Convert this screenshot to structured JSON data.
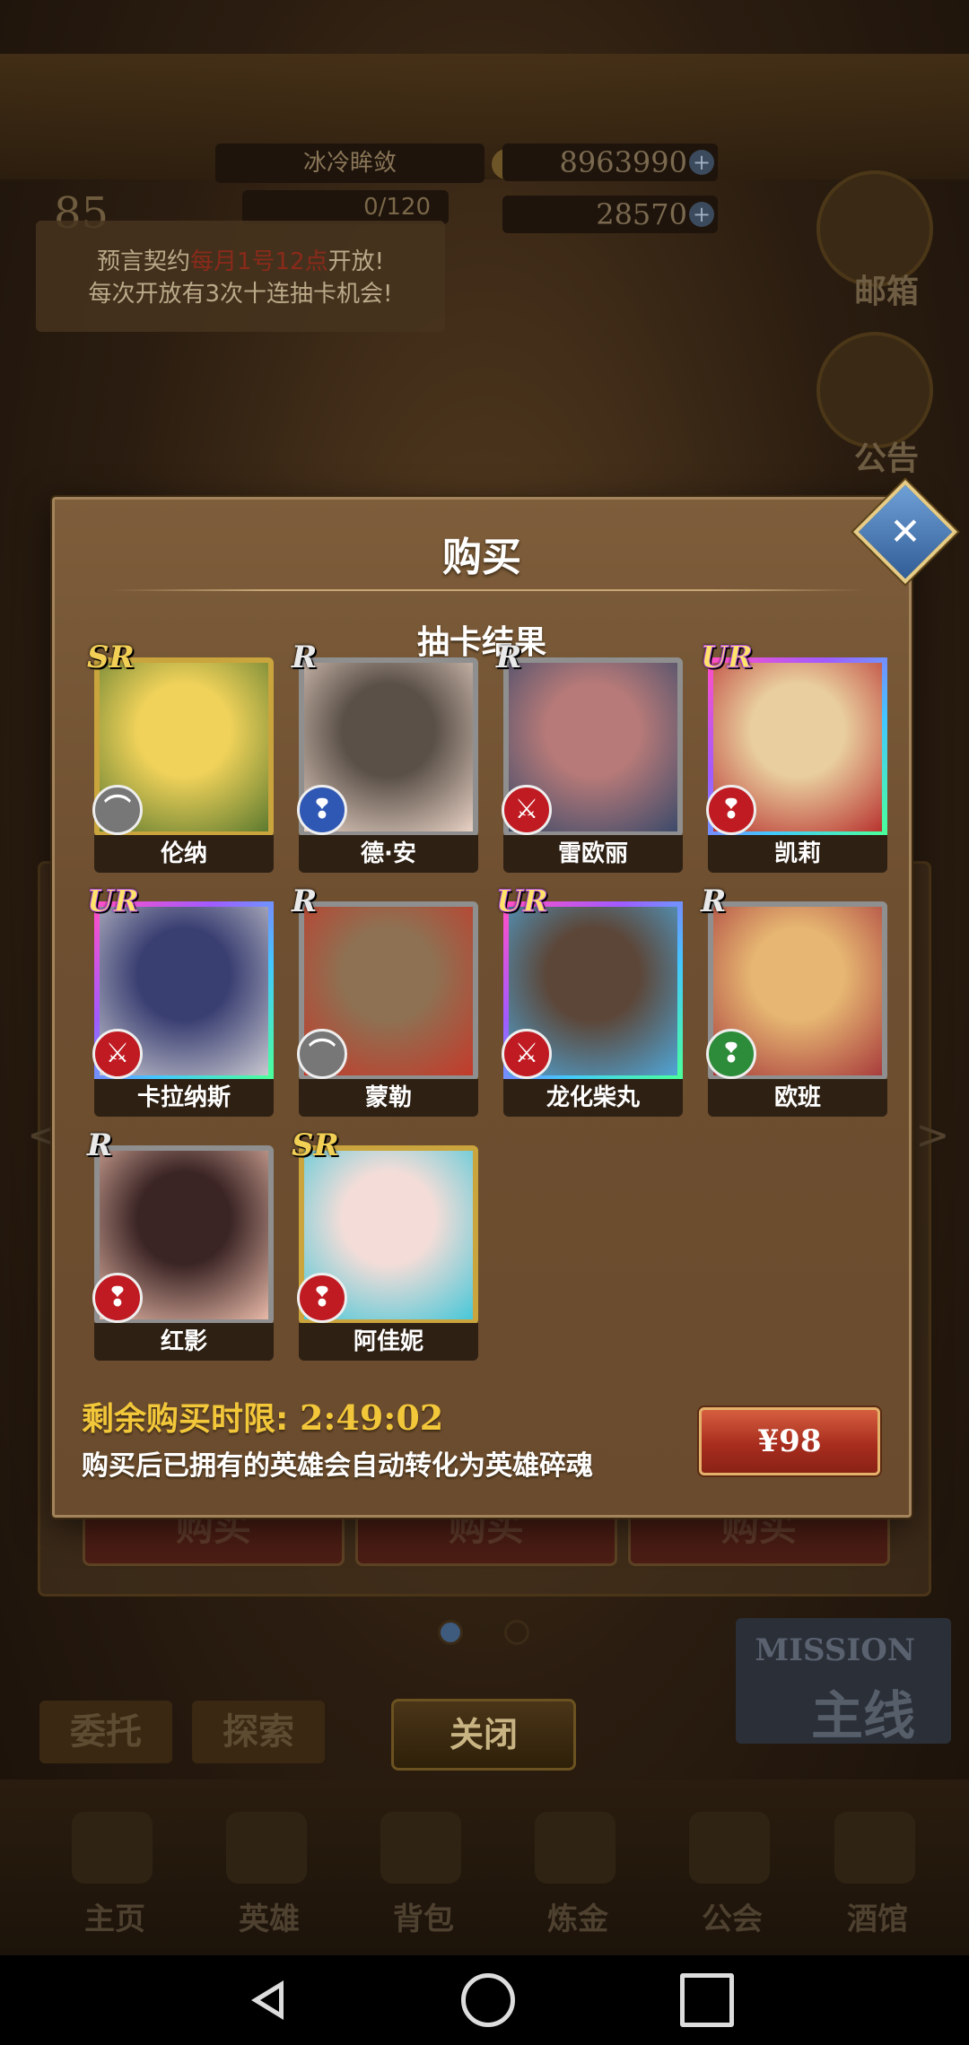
{
  "background": {
    "player_name": "冰冷眸敛",
    "level": "85",
    "exp": "0/120",
    "gold": "8963990",
    "gems": "28570",
    "notice_line1_prefix": "预言契约",
    "notice_line1_time": "每月1号12点",
    "notice_line1_suffix": "开放!",
    "notice_line2": "每次开放有3次十连抽卡机会!",
    "side_mail": "邮箱",
    "side_announce": "公告",
    "buy_buttons": [
      "购买",
      "购买",
      "购买"
    ],
    "tags": [
      "委托",
      "探索"
    ],
    "mission_en": "MISSION",
    "mission_cn": "主线",
    "close": "关闭",
    "nav": [
      "主页",
      "英雄",
      "背包",
      "炼金",
      "公会",
      "酒馆"
    ]
  },
  "modal": {
    "title": "购买",
    "subtitle": "抽卡结果",
    "timer_label": "剩余购买时限:",
    "timer_value": "2:49:02",
    "note": "购买后已拥有的英雄会自动转化为英雄碎魂",
    "price": "¥98",
    "close_icon": "close-icon"
  },
  "cards": [
    {
      "name": "伦纳",
      "rarity": "SR",
      "class_icon": "bow-icon",
      "class_color": "grey",
      "art": [
        "#f0d25a",
        "#5d7a2f"
      ]
    },
    {
      "name": "德·安",
      "rarity": "R",
      "class_icon": "staff-icon",
      "class_color": "blue",
      "art": [
        "#5a5048",
        "#e8d2c4"
      ]
    },
    {
      "name": "雷欧丽",
      "rarity": "R",
      "class_icon": "sword-icon",
      "class_color": "red",
      "art": [
        "#b77a78",
        "#3c4a6a"
      ]
    },
    {
      "name": "凯莉",
      "rarity": "UR",
      "class_icon": "staff-icon",
      "class_color": "red",
      "art": [
        "#e9cf9f",
        "#b8332f"
      ]
    },
    {
      "name": "卡拉纳斯",
      "rarity": "UR",
      "class_icon": "sword-icon",
      "class_color": "red",
      "art": [
        "#3a3f72",
        "#c8c8d0"
      ]
    },
    {
      "name": "蒙勒",
      "rarity": "R",
      "class_icon": "bow-icon",
      "class_color": "grey",
      "art": [
        "#8e7152",
        "#c43a2a"
      ]
    },
    {
      "name": "龙化柴丸",
      "rarity": "UR",
      "class_icon": "sword-icon",
      "class_color": "red",
      "art": [
        "#5c4638",
        "#4fa6d8"
      ]
    },
    {
      "name": "欧班",
      "rarity": "R",
      "class_icon": "staff-icon",
      "class_color": "green",
      "art": [
        "#e6b672",
        "#a83c3c"
      ]
    },
    {
      "name": "红影",
      "rarity": "R",
      "class_icon": "staff-icon",
      "class_color": "red",
      "art": [
        "#3a2424",
        "#e8b9a8"
      ]
    },
    {
      "name": "阿佳妮",
      "rarity": "SR",
      "class_icon": "staff-icon",
      "class_color": "red",
      "art": [
        "#f4ddd8",
        "#47c7d8"
      ]
    }
  ]
}
